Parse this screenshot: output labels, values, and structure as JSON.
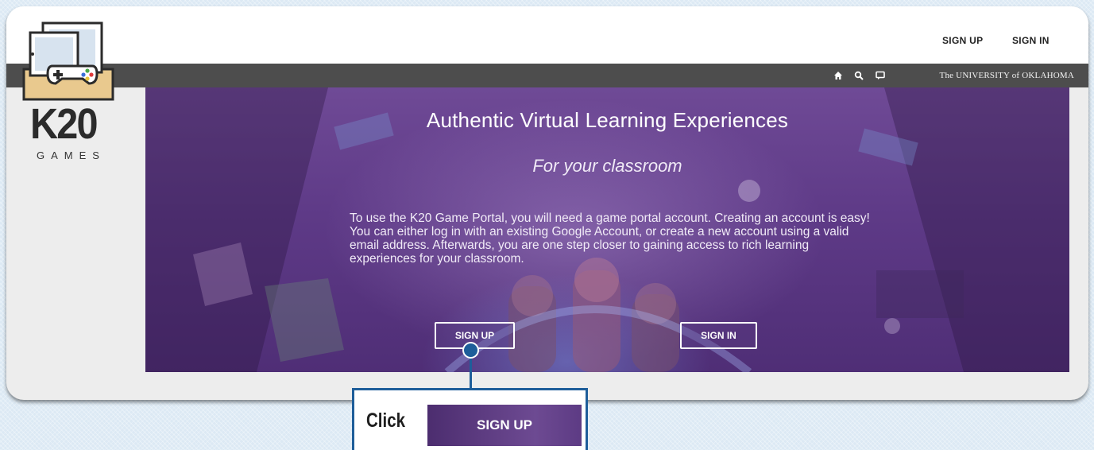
{
  "nav": {
    "sign_up": "SIGN UP",
    "sign_in": "SIGN IN"
  },
  "utility_bar": {
    "icons": [
      "home-icon",
      "search-icon",
      "chat-icon"
    ],
    "university": "The UNIVERSITY of OKLAHOMA"
  },
  "logo": {
    "title": "K20",
    "subtitle": "GAMES"
  },
  "hero": {
    "title": "Authentic Virtual Learning Experiences",
    "subtitle": "For your classroom",
    "body": "To use the K20 Game Portal, you will need a game portal account. Creating an account is easy! You can either log in with an existing Google Account, or create a new account using a valid email address. Afterwards, you are one step closer to gaining access to rich learning experiences for your classroom.",
    "sign_up": "SIGN UP",
    "sign_in": "SIGN IN"
  },
  "callout": {
    "label": "Click",
    "button": "SIGN UP"
  },
  "colors": {
    "hero_purple": "#5e3a87",
    "dark_bar": "#4d4d4d",
    "callout_blue": "#1e5e9a"
  }
}
